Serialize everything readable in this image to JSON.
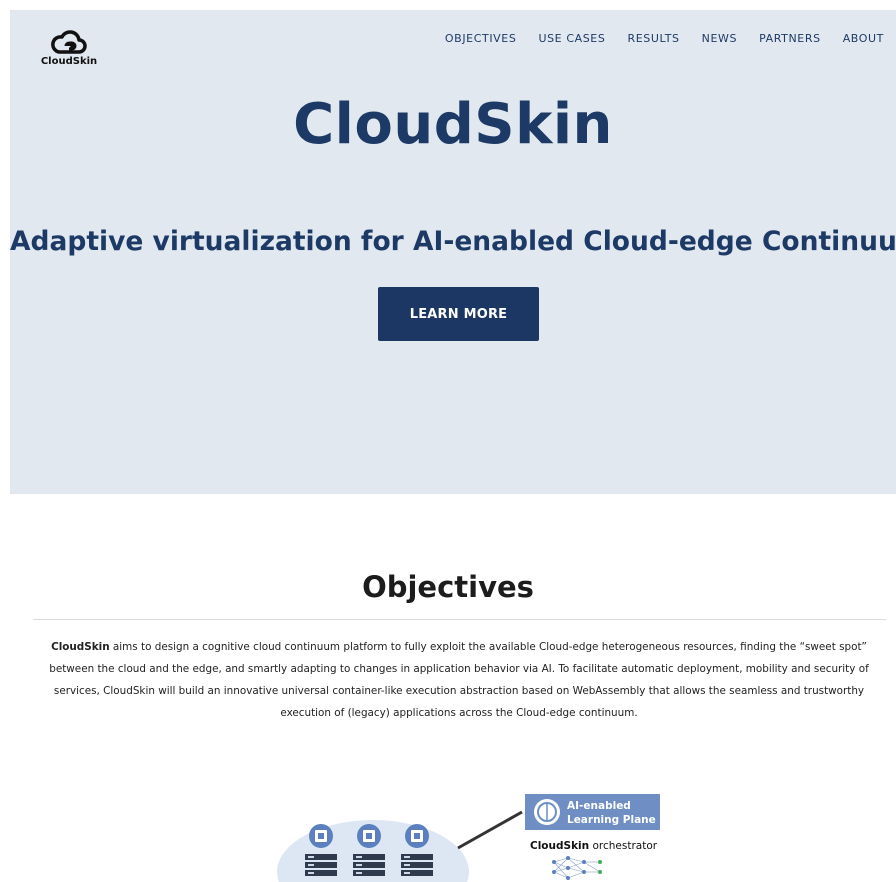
{
  "brand": {
    "logo_text": "CloudSkin"
  },
  "nav": {
    "items": [
      "OBJECTIVES",
      "USE CASES",
      "RESULTS",
      "NEWS",
      "PARTNERS",
      "ABOUT"
    ]
  },
  "hero": {
    "title": "CloudSkin",
    "subtitle": "Adaptive virtualization for AI-enabled Cloud-edge Continuum",
    "button_label": "LEARN MORE"
  },
  "objectives": {
    "heading": "Objectives",
    "lead": "CloudSkin",
    "body": " aims to design a cognitive cloud continuum platform to fully exploit the available Cloud-edge heterogeneous resources, finding the “sweet spot” between the cloud and the edge, and smartly adapting to changes in application behavior via AI. To facilitate automatic deployment, mobility and security of services, CloudSkin will build an innovative universal container-like execution abstraction based on WebAssembly that allows the seamless and trustworthy execution of (legacy) applications across the Cloud-edge continuum."
  },
  "diagram": {
    "plane_label_1": "AI-enabled",
    "plane_label_2": "Learning Plane",
    "orchestrator_brand": "CloudSkin",
    "orchestrator_word": " orchestrator"
  },
  "colors": {
    "navy": "#1d3765",
    "hero_bg": "#e2e8ef",
    "diagram_blue": "#5b7fbf"
  }
}
